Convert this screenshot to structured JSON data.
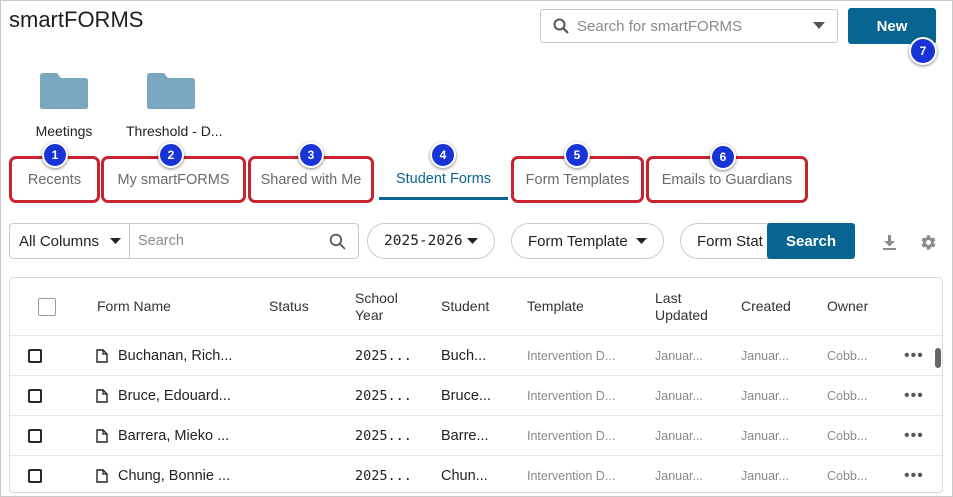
{
  "app": {
    "title": "smartFORMS"
  },
  "top_search": {
    "placeholder": "Search for smartFORMS"
  },
  "new_button": {
    "label": "New"
  },
  "folders": [
    {
      "label": "Meetings",
      "icon": "folder-icon"
    },
    {
      "label": "Threshold - D...",
      "icon": "folder-icon"
    }
  ],
  "tabs": [
    {
      "label": "Recents",
      "badge": "1"
    },
    {
      "label": "My smartFORMS",
      "badge": "2"
    },
    {
      "label": "Shared with Me",
      "badge": "3"
    },
    {
      "label": "Student Forms",
      "badge": "4",
      "active": true
    },
    {
      "label": "Form Templates",
      "badge": "5"
    },
    {
      "label": "Emails to Guardians",
      "badge": "6"
    }
  ],
  "new_badge": "7",
  "filters": {
    "column_select": "All Columns",
    "search_placeholder": "Search",
    "year": "2025-2026",
    "form_template": "Form Template",
    "form_status": "Form Stat",
    "search_button": "Search"
  },
  "table": {
    "headers": {
      "form_name": "Form Name",
      "status": "Status",
      "school_year_1": "School",
      "school_year_2": "Year",
      "student": "Student",
      "template": "Template",
      "last_updated_1": "Last",
      "last_updated_2": "Updated",
      "created": "Created",
      "owner": "Owner"
    },
    "rows": [
      {
        "name": "Buchanan, Rich...",
        "year": "2025...",
        "student": "Buch...",
        "template": "Intervention D...",
        "updated": "Januar...",
        "created": "Januar...",
        "owner": "Cobb..."
      },
      {
        "name": "Bruce, Edouard...",
        "year": "2025...",
        "student": "Bruce...",
        "template": "Intervention D...",
        "updated": "Januar...",
        "created": "Januar...",
        "owner": "Cobb..."
      },
      {
        "name": "Barrera, Mieko ...",
        "year": "2025...",
        "student": "Barre...",
        "template": "Intervention D...",
        "updated": "Januar...",
        "created": "Januar...",
        "owner": "Cobb..."
      },
      {
        "name": "Chung, Bonnie ...",
        "year": "2025...",
        "student": "Chun...",
        "template": "Intervention D...",
        "updated": "Januar...",
        "created": "Januar...",
        "owner": "Cobb..."
      }
    ]
  },
  "colors": {
    "primary": "#086591",
    "highlight": "#c8232f",
    "badge": "#1834d6",
    "folder": "#79a8c0"
  }
}
